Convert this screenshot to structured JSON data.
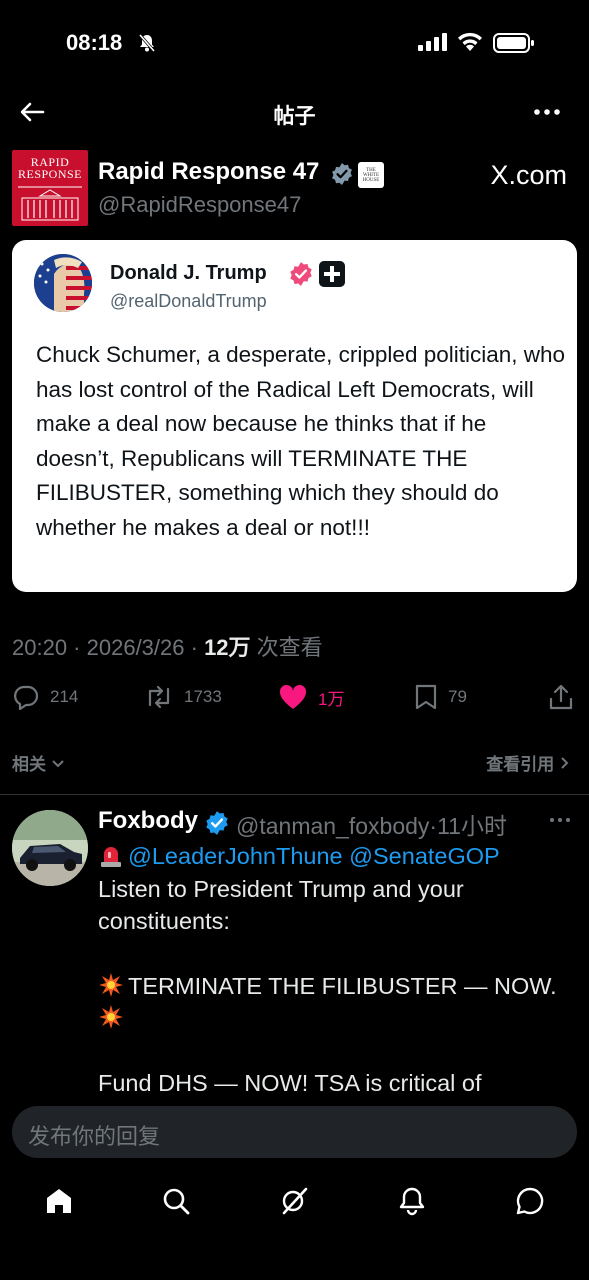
{
  "status_bar": {
    "time": "08:18"
  },
  "header": {
    "title": "帖子"
  },
  "post": {
    "author_name": "Rapid Response 47",
    "author_handle": "@RapidResponse47",
    "avatar_text_line1": "RAPID",
    "avatar_text_line2": "RESPONSE",
    "affiliate_badge_text": "THE WHITE HOUSE",
    "source": "X.com",
    "quoted": {
      "author_name": "Donald J. Trump",
      "author_handle": "@realDonaldTrump",
      "text": "Chuck Schumer, a desperate, crippled politician, who has lost control of the Radical Left Democrats, will make a deal now because he thinks that if he doesn’t, Republicans will TERMINATE THE FILIBUSTER, something which they should do whether he makes a deal or not!!!"
    },
    "time": "20:20",
    "date": "2026/3/26",
    "views_count": "12万",
    "views_label": "次查看",
    "replies": "214",
    "reposts": "1733",
    "likes": "1万",
    "bookmarks": "79"
  },
  "related_label": "相关",
  "view_quotes_label": "查看引用",
  "reply": {
    "author_name": "Foxbody",
    "author_handle": "@tanman_foxbody",
    "time_ago": "11小时",
    "mention1": "@LeaderJohnThune",
    "mention2": "@SenateGOP",
    "line1": "Listen to President Trump and your constituents:",
    "line2": "TERMINATE THE FILIBUSTER — NOW.",
    "line3": "Fund DHS — NOW! TSA is critical of"
  },
  "compose": {
    "placeholder": "发布你的回复"
  },
  "colors": {
    "accent": "#1d9bf0",
    "like": "#f91880",
    "muted": "#71767b",
    "background": "#000000"
  },
  "icons": {
    "nav": [
      "home-icon",
      "search-icon",
      "grok-icon",
      "notifications-icon",
      "messages-icon"
    ]
  }
}
